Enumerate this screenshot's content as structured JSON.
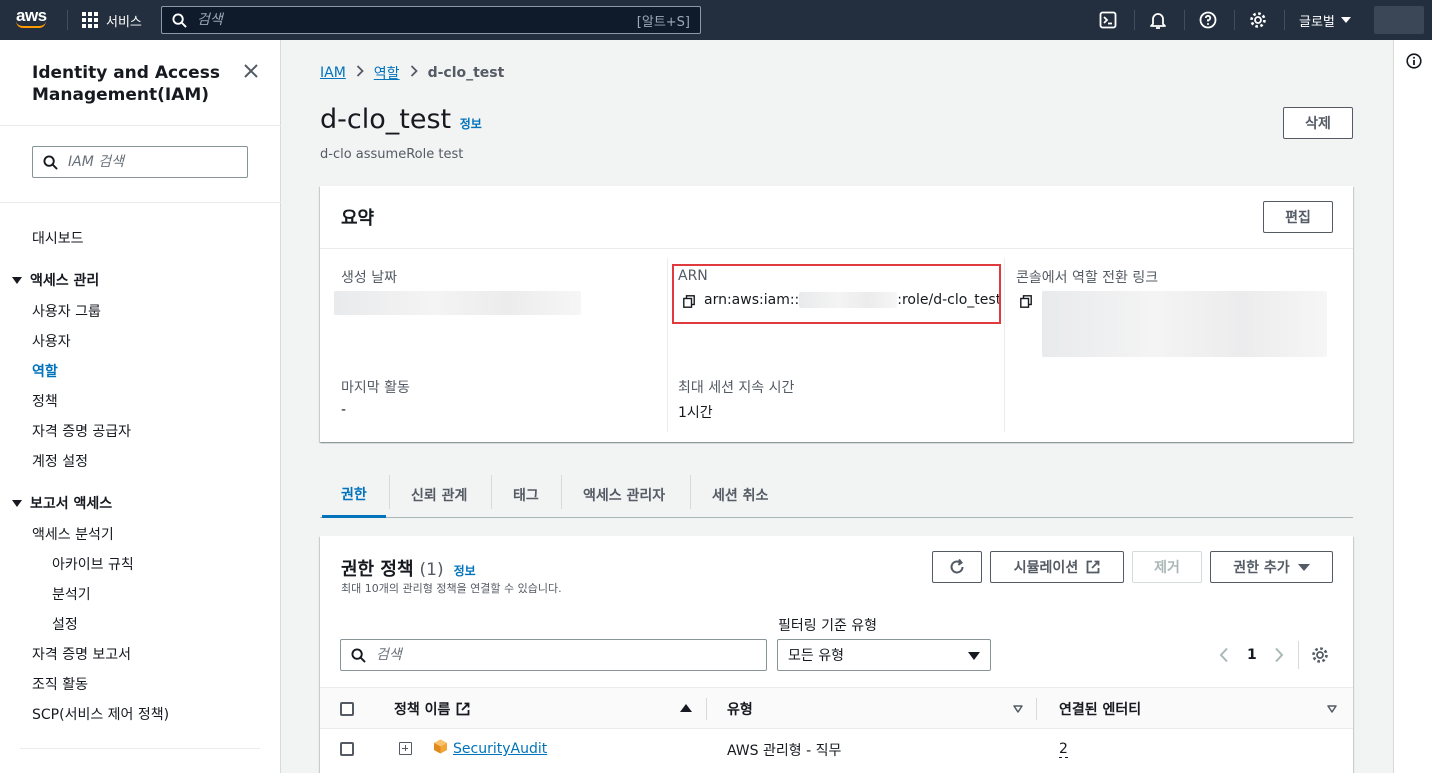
{
  "topnav": {
    "logo": "aws",
    "services_label": "서비스",
    "search_placeholder": "검색",
    "search_shortcut": "[알트+S]",
    "region_label": "글로벌",
    "icons": [
      "cloudshell-icon",
      "bell-icon",
      "help-icon",
      "gear-icon"
    ]
  },
  "sidebar": {
    "title": "Identity and Access Management(IAM)",
    "search_placeholder": "IAM 검색",
    "dashboard": "대시보드",
    "access_mgmt": {
      "header": "액세스 관리",
      "items": [
        "사용자 그룹",
        "사용자",
        "역할",
        "정책",
        "자격 증명 공급자",
        "계정 설정"
      ],
      "active": "역할"
    },
    "report_access": {
      "header": "보고서 액세스",
      "items": [
        "액세스 분석기",
        "아카이브 규칙",
        "분석기",
        "설정",
        "자격 증명 보고서",
        "조직 활동",
        "SCP(서비스 제어 정책)"
      ]
    }
  },
  "breadcrumb": [
    "IAM",
    "역할",
    "d-clo_test"
  ],
  "page": {
    "title": "d-clo_test",
    "info": "정보",
    "description": "d-clo assumeRole test",
    "delete_button": "삭제"
  },
  "summary": {
    "title": "요약",
    "edit_button": "편집",
    "created_label": "생성 날짜",
    "arn_label": "ARN",
    "arn_prefix": "arn:aws:iam::",
    "arn_suffix": ":role/d-clo_test",
    "switch_link_label": "콘솔에서 역할 전환 링크",
    "last_activity_label": "마지막 활동",
    "last_activity_value": "-",
    "max_session_label": "최대 세션 지속 시간",
    "max_session_value": "1시간",
    "highlight_color": "#e0393e"
  },
  "tabs": [
    "권한",
    "신뢰 관계",
    "태그",
    "액세스 관리자",
    "세션 취소"
  ],
  "active_tab": "권한",
  "policies": {
    "title": "권한 정책",
    "count": "(1)",
    "info": "정보",
    "description": "최대 10개의 관리형 정책을 연결할 수 있습니다.",
    "simulate_button": "시뮬레이션",
    "remove_button": "제거",
    "add_button": "권한 추가",
    "filter_label": "필터링 기준 유형",
    "search_placeholder": "검색",
    "type_select": "모든 유형",
    "page_number": "1",
    "columns": [
      "정책 이름",
      "유형",
      "연결된 엔터티"
    ],
    "rows": [
      {
        "name": "SecurityAudit",
        "type": "AWS 관리형 - 직무",
        "attached": "2"
      }
    ]
  },
  "colors": {
    "nav_bg": "#232f3e",
    "link": "#0073bb",
    "accent": "#ff9900"
  }
}
